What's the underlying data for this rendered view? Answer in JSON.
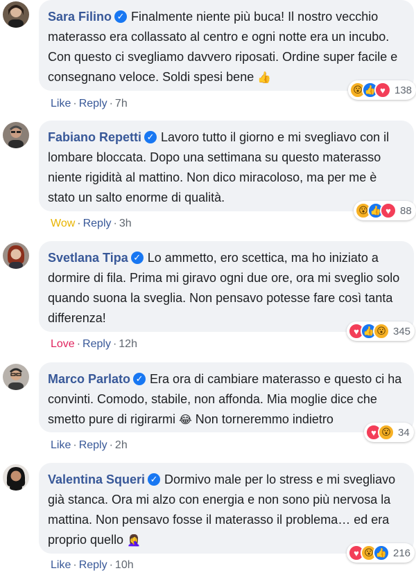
{
  "comments": [
    {
      "name": "Sara Filino",
      "text": "Finalmente niente più buca! Il nostro vecchio materasso era collassato al centro e ogni notte era un incubo. Con questo ci svegliamo davvero riposati. Ordine super facile e consegnano veloce. Soldi spesi bene",
      "emoji": "👍",
      "reaction_label": "Like",
      "reply": "Reply",
      "time": "7h",
      "reactions": [
        "wow",
        "like",
        "love"
      ],
      "count": "138"
    },
    {
      "name": "Fabiano Repetti",
      "text": "Lavoro tutto il giorno e mi svegliavo con il lombare bloccata. Dopo una settimana su questo materasso niente rigidità al mattino. Non dico miracoloso, ma per me è stato un salto enorme di qualità.",
      "emoji": "",
      "reaction_label": "Wow",
      "reply": "Reply",
      "time": "3h",
      "reactions": [
        "wow",
        "like",
        "love"
      ],
      "count": "88"
    },
    {
      "name": "Svetlana Tipa",
      "text": "Lo ammetto, ero scettica, ma ho iniziato a dormire di fila. Prima mi giravo ogni due ore, ora mi sveglio solo quando suona la sveglia. Non pensavo potesse fare così tanta differenza!",
      "emoji": "",
      "reaction_label": "Love",
      "reply": "Reply",
      "time": "12h",
      "reactions": [
        "love",
        "like",
        "wow"
      ],
      "count": "345"
    },
    {
      "name": "Marco Parlato",
      "text": "Era ora di cambiare materasso e questo ci ha convinti. Comodo, stabile, non affonda. Mia moglie dice che smetto pure di rigirarmi",
      "emoji": "😂",
      "text_after": "Non torneremmo indietro",
      "reaction_label": "Like",
      "reply": "Reply",
      "time": "2h",
      "reactions": [
        "love",
        "wow"
      ],
      "count": "34"
    },
    {
      "name": "Valentina Squeri",
      "text": "Dormivo male per lo stress e mi svegliavo già stanca. Ora mi alzo con energia e non sono più nervosa la mattina. Non pensavo fosse il materasso il problema… ed era proprio quello",
      "emoji": "🤦‍♀️",
      "reaction_label": "Like",
      "reply": "Reply",
      "time": "10h",
      "reactions": [
        "love",
        "wow",
        "like"
      ],
      "count": "216"
    }
  ],
  "colors": {
    "name": "#385898",
    "bubble": "#f0f2f5",
    "like": "#1877f2",
    "love": "#f33e58",
    "wow": "#f7b125"
  }
}
